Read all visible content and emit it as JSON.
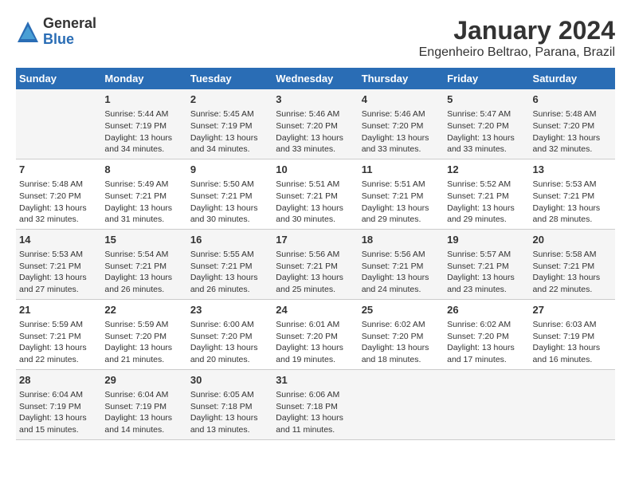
{
  "header": {
    "logo_general": "General",
    "logo_blue": "Blue",
    "title": "January 2024",
    "subtitle": "Engenheiro Beltrao, Parana, Brazil"
  },
  "calendar": {
    "weekdays": [
      "Sunday",
      "Monday",
      "Tuesday",
      "Wednesday",
      "Thursday",
      "Friday",
      "Saturday"
    ],
    "weeks": [
      [
        {
          "day": "",
          "info": ""
        },
        {
          "day": "1",
          "info": "Sunrise: 5:44 AM\nSunset: 7:19 PM\nDaylight: 13 hours\nand 34 minutes."
        },
        {
          "day": "2",
          "info": "Sunrise: 5:45 AM\nSunset: 7:19 PM\nDaylight: 13 hours\nand 34 minutes."
        },
        {
          "day": "3",
          "info": "Sunrise: 5:46 AM\nSunset: 7:20 PM\nDaylight: 13 hours\nand 33 minutes."
        },
        {
          "day": "4",
          "info": "Sunrise: 5:46 AM\nSunset: 7:20 PM\nDaylight: 13 hours\nand 33 minutes."
        },
        {
          "day": "5",
          "info": "Sunrise: 5:47 AM\nSunset: 7:20 PM\nDaylight: 13 hours\nand 33 minutes."
        },
        {
          "day": "6",
          "info": "Sunrise: 5:48 AM\nSunset: 7:20 PM\nDaylight: 13 hours\nand 32 minutes."
        }
      ],
      [
        {
          "day": "7",
          "info": "Sunrise: 5:48 AM\nSunset: 7:20 PM\nDaylight: 13 hours\nand 32 minutes."
        },
        {
          "day": "8",
          "info": "Sunrise: 5:49 AM\nSunset: 7:21 PM\nDaylight: 13 hours\nand 31 minutes."
        },
        {
          "day": "9",
          "info": "Sunrise: 5:50 AM\nSunset: 7:21 PM\nDaylight: 13 hours\nand 30 minutes."
        },
        {
          "day": "10",
          "info": "Sunrise: 5:51 AM\nSunset: 7:21 PM\nDaylight: 13 hours\nand 30 minutes."
        },
        {
          "day": "11",
          "info": "Sunrise: 5:51 AM\nSunset: 7:21 PM\nDaylight: 13 hours\nand 29 minutes."
        },
        {
          "day": "12",
          "info": "Sunrise: 5:52 AM\nSunset: 7:21 PM\nDaylight: 13 hours\nand 29 minutes."
        },
        {
          "day": "13",
          "info": "Sunrise: 5:53 AM\nSunset: 7:21 PM\nDaylight: 13 hours\nand 28 minutes."
        }
      ],
      [
        {
          "day": "14",
          "info": "Sunrise: 5:53 AM\nSunset: 7:21 PM\nDaylight: 13 hours\nand 27 minutes."
        },
        {
          "day": "15",
          "info": "Sunrise: 5:54 AM\nSunset: 7:21 PM\nDaylight: 13 hours\nand 26 minutes."
        },
        {
          "day": "16",
          "info": "Sunrise: 5:55 AM\nSunset: 7:21 PM\nDaylight: 13 hours\nand 26 minutes."
        },
        {
          "day": "17",
          "info": "Sunrise: 5:56 AM\nSunset: 7:21 PM\nDaylight: 13 hours\nand 25 minutes."
        },
        {
          "day": "18",
          "info": "Sunrise: 5:56 AM\nSunset: 7:21 PM\nDaylight: 13 hours\nand 24 minutes."
        },
        {
          "day": "19",
          "info": "Sunrise: 5:57 AM\nSunset: 7:21 PM\nDaylight: 13 hours\nand 23 minutes."
        },
        {
          "day": "20",
          "info": "Sunrise: 5:58 AM\nSunset: 7:21 PM\nDaylight: 13 hours\nand 22 minutes."
        }
      ],
      [
        {
          "day": "21",
          "info": "Sunrise: 5:59 AM\nSunset: 7:21 PM\nDaylight: 13 hours\nand 22 minutes."
        },
        {
          "day": "22",
          "info": "Sunrise: 5:59 AM\nSunset: 7:20 PM\nDaylight: 13 hours\nand 21 minutes."
        },
        {
          "day": "23",
          "info": "Sunrise: 6:00 AM\nSunset: 7:20 PM\nDaylight: 13 hours\nand 20 minutes."
        },
        {
          "day": "24",
          "info": "Sunrise: 6:01 AM\nSunset: 7:20 PM\nDaylight: 13 hours\nand 19 minutes."
        },
        {
          "day": "25",
          "info": "Sunrise: 6:02 AM\nSunset: 7:20 PM\nDaylight: 13 hours\nand 18 minutes."
        },
        {
          "day": "26",
          "info": "Sunrise: 6:02 AM\nSunset: 7:20 PM\nDaylight: 13 hours\nand 17 minutes."
        },
        {
          "day": "27",
          "info": "Sunrise: 6:03 AM\nSunset: 7:19 PM\nDaylight: 13 hours\nand 16 minutes."
        }
      ],
      [
        {
          "day": "28",
          "info": "Sunrise: 6:04 AM\nSunset: 7:19 PM\nDaylight: 13 hours\nand 15 minutes."
        },
        {
          "day": "29",
          "info": "Sunrise: 6:04 AM\nSunset: 7:19 PM\nDaylight: 13 hours\nand 14 minutes."
        },
        {
          "day": "30",
          "info": "Sunrise: 6:05 AM\nSunset: 7:18 PM\nDaylight: 13 hours\nand 13 minutes."
        },
        {
          "day": "31",
          "info": "Sunrise: 6:06 AM\nSunset: 7:18 PM\nDaylight: 13 hours\nand 11 minutes."
        },
        {
          "day": "",
          "info": ""
        },
        {
          "day": "",
          "info": ""
        },
        {
          "day": "",
          "info": ""
        }
      ]
    ]
  }
}
